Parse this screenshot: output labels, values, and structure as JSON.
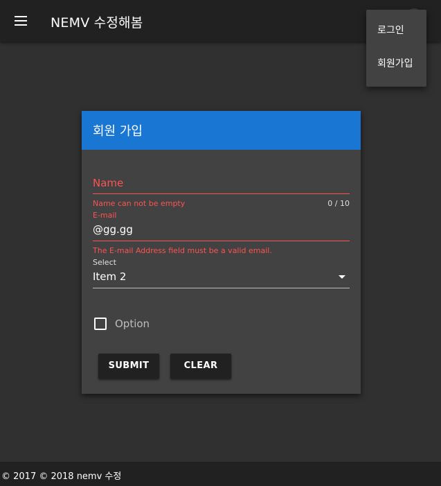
{
  "app": {
    "title": "NEMV 수정해봄",
    "menu_icon": "hamburger-menu-icon"
  },
  "account_menu": {
    "items": [
      {
        "label": "로그인"
      },
      {
        "label": "회원가입"
      }
    ]
  },
  "signup_card": {
    "title": "회원 가입",
    "header_color": "#1976d2",
    "name_field": {
      "label": "Name",
      "value": "",
      "error": "Name can not be empty",
      "counter": "0 / 10"
    },
    "email_field": {
      "label": "E-mail",
      "value": "@gg.gg",
      "error": "The E-mail Address field must be a valid email."
    },
    "select_field": {
      "label": "Select",
      "value": "Item 2",
      "icon": "arrow-drop-down-icon"
    },
    "checkbox": {
      "label": "Option",
      "checked": false
    },
    "buttons": {
      "submit": "SUBMIT",
      "clear": "CLEAR"
    }
  },
  "footer": {
    "text": "© 2017 © 2018 nemv 수정"
  },
  "colors": {
    "error": "#ff5252",
    "toolbar": "#212121",
    "background": "#303030",
    "card": "#424242"
  }
}
